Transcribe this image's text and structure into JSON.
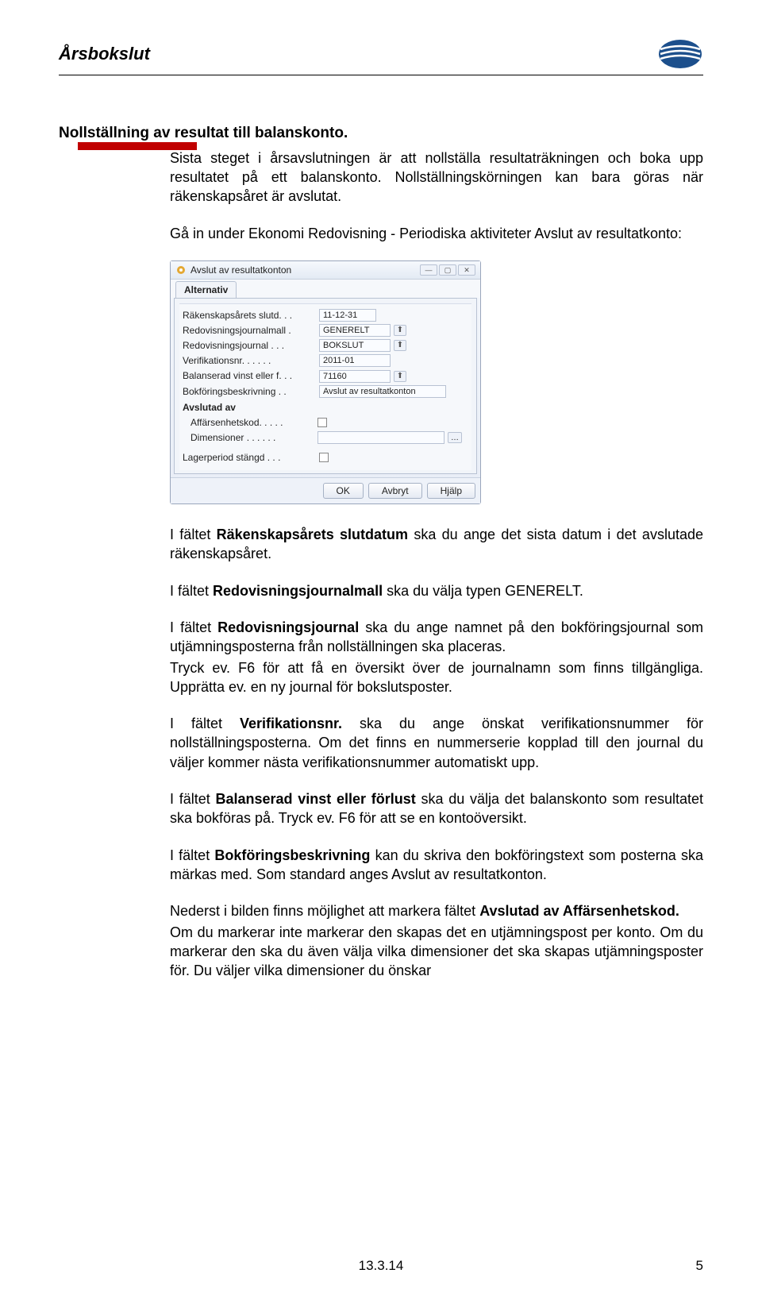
{
  "header": {
    "doc_title": "Årsbokslut"
  },
  "section_heading": "Nollställning av resultat till balanskonto.",
  "paragraphs": {
    "p1a": "Sista steget i årsavslutningen är att nollställa resultaträkningen och boka upp resultatet på ett balanskonto. Nollställningskörningen kan bara göras när räkenskapsåret är avslutat.",
    "p1b": "Gå in under Ekonomi Redovisning - Periodiska aktiviteter Avslut av resultatkonto:",
    "p2_pre": "I fältet ",
    "p2_bold": "Räkenskapsårets slutdatum",
    "p2_post": " ska du ange det sista datum i det avslutade räkenskapsåret.",
    "p3_pre": "I fältet ",
    "p3_bold": "Redovisningsjournalmall",
    "p3_post": " ska du välja typen GENERELT.",
    "p4_pre": "I fältet ",
    "p4_bold": "Redovisningsjournal",
    "p4_post": " ska du ange namnet på den bokföringsjournal som utjämningsposterna från nollställningen ska placeras.",
    "p4b": "Tryck ev. F6 för att få en översikt över de journalnamn som finns tillgängliga. Upprätta ev. en ny journal för bokslutsposter.",
    "p5_pre": "I fältet ",
    "p5_bold": "Verifikationsnr.",
    "p5_post": " ska du ange önskat verifikationsnummer för nollställningsposterna. Om det finns en nummerserie kopplad till den journal du väljer kommer nästa verifikationsnummer automatiskt upp.",
    "p6_pre": "I fältet ",
    "p6_bold": "Balanserad vinst eller förlust",
    "p6_post": " ska du välja det balanskonto som resultatet ska bokföras på. Tryck ev. F6 för att se en kontoöversikt.",
    "p7_pre": "I fältet ",
    "p7_bold": "Bokföringsbeskrivning",
    "p7_post": " kan du skriva den bokföringstext som posterna ska märkas med. Som standard anges Avslut av resultatkonton.",
    "p8a": "Nederst i bilden finns möjlighet att markera fältet ",
    "p8a_bold": "Avslutad av Affärsenhetskod.",
    "p8b": "Om du markerar inte markerar den skapas det en utjämningspost per konto. Om du markerar den ska du även välja vilka dimensioner det ska skapas utjämningsposter för. Du väljer vilka dimensioner du önskar"
  },
  "dialog": {
    "title": "Avslut av resultatkonton",
    "tab": "Alternativ",
    "fields": {
      "f1_label": "Räkenskapsårets slutd. . .",
      "f1_value": "11-12-31",
      "f2_label": "Redovisningsjournalmall .",
      "f2_value": "GENERELT",
      "f3_label": "Redovisningsjournal . . .",
      "f3_value": "BOKSLUT",
      "f4_label": "Verifikationsnr. . . . . .",
      "f4_value": "2011-01",
      "f5_label": "Balanserad vinst eller f. . .",
      "f5_value": "71160",
      "f6_label": "Bokföringsbeskrivning . .",
      "f6_value": "Avslut av resultatkonton",
      "subhead": "Avslutad av",
      "f7_label": "Affärsenhetskod. . . . .",
      "f8_label": "Dimensioner . . . . . .",
      "f9_label": "Lagerperiod stängd . . ."
    },
    "buttons": {
      "ok": "OK",
      "cancel": "Avbryt",
      "help": "Hjälp"
    }
  },
  "footer": {
    "date": "13.3.14",
    "page": "5"
  }
}
